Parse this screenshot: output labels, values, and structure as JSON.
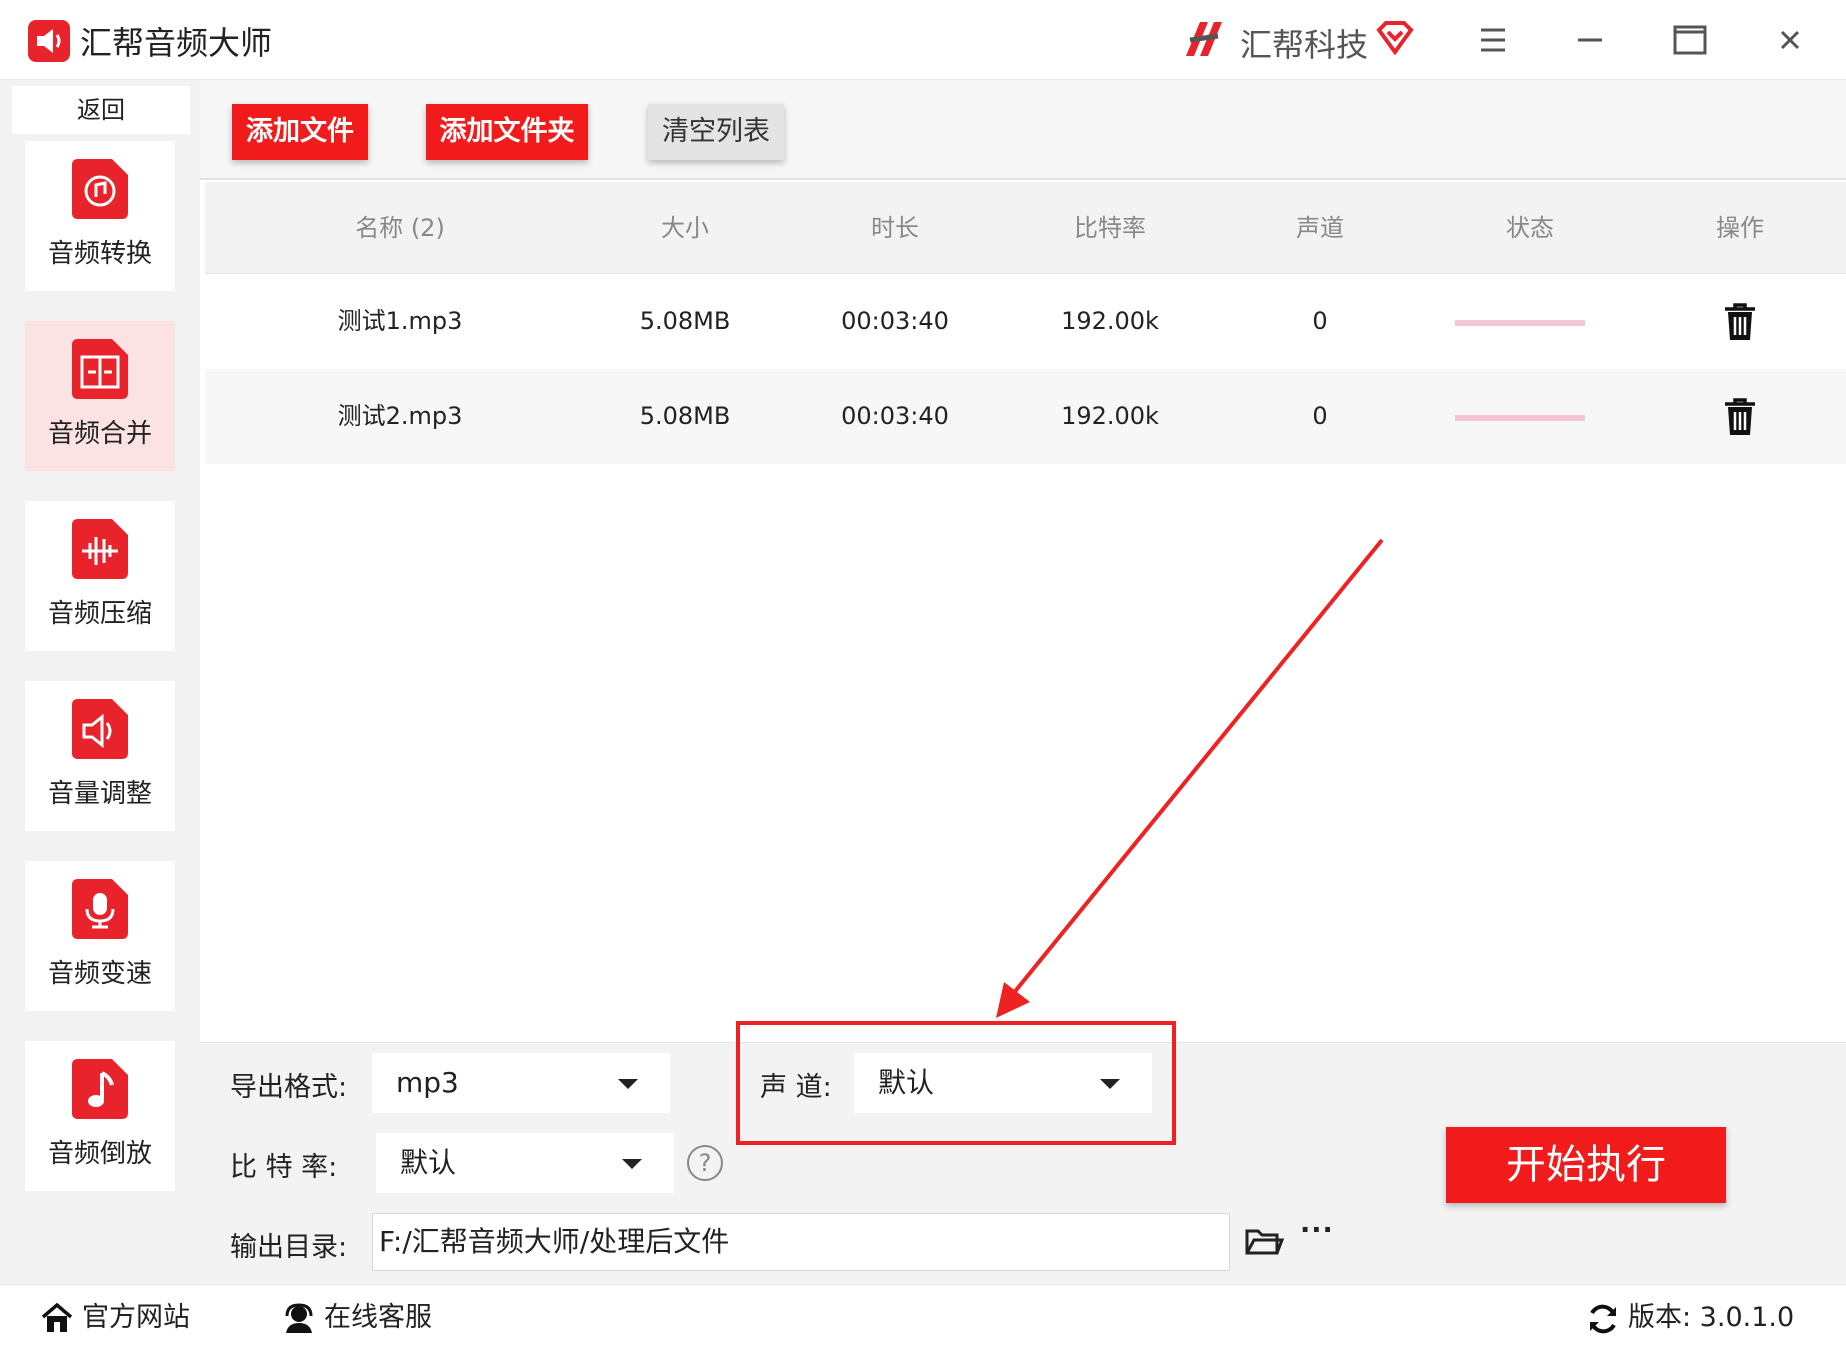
{
  "app": {
    "title": "汇帮音频大师",
    "brand": "汇帮科技",
    "accent": "#f21b1b"
  },
  "sidebar": {
    "back_label": "返回",
    "items": [
      {
        "label": "音频转换",
        "icon": "audio-convert-icon"
      },
      {
        "label": "音频合并",
        "icon": "audio-merge-icon",
        "active": true
      },
      {
        "label": "音频压缩",
        "icon": "audio-compress-icon"
      },
      {
        "label": "音量调整",
        "icon": "volume-icon"
      },
      {
        "label": "音频变速",
        "icon": "microphone-icon"
      },
      {
        "label": "音频倒放",
        "icon": "music-note-icon"
      }
    ]
  },
  "toolbar": {
    "add_file": "添加文件",
    "add_folder": "添加文件夹",
    "clear_list": "清空列表"
  },
  "table": {
    "headers": [
      "名称 (2)",
      "大小",
      "时长",
      "比特率",
      "声道",
      "状态",
      "操作"
    ],
    "rows": [
      {
        "name": "测试1.mp3",
        "size": "5.08MB",
        "duration": "00:03:40",
        "bitrate": "192.00k",
        "channel": "0"
      },
      {
        "name": "测试2.mp3",
        "size": "5.08MB",
        "duration": "00:03:40",
        "bitrate": "192.00k",
        "channel": "0"
      }
    ]
  },
  "settings": {
    "format_label": "导出格式:",
    "format_value": "mp3",
    "channel_label": "声 道:",
    "channel_value": "默认",
    "bitrate_label": "比 特 率:",
    "bitrate_value": "默认",
    "help_symbol": "?",
    "output_label": "输出目录:",
    "output_path": "F:/汇帮音频大师/处理后文件",
    "more_symbol": "···",
    "start_label": "开始执行"
  },
  "footer": {
    "website": "官方网站",
    "support": "在线客服",
    "version": "版本: 3.0.1.0"
  }
}
